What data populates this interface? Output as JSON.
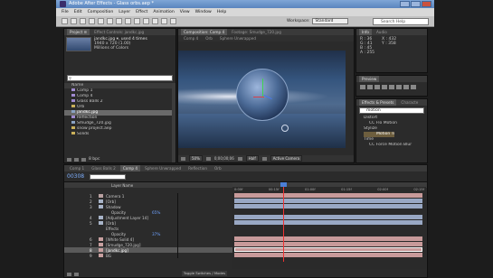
{
  "window": {
    "title": "Adobe After Effects - Glass orbs.aep *"
  },
  "menu": [
    "File",
    "Edit",
    "Composition",
    "Layer",
    "Effect",
    "Animation",
    "View",
    "Window",
    "Help"
  ],
  "toolbar": {
    "workspace_label": "Workspace:",
    "workspace_value": "Standard",
    "search_placeholder": "Search Help"
  },
  "project": {
    "tabs": [
      "Project ≡",
      "Effect Controls: jandkc.jpg"
    ],
    "preview_name": "jandkc.jpg ▾, used 4 times",
    "preview_size": "1940 x 720 (1.00)",
    "preview_desc": "Millions of Colors",
    "column_name": "Name",
    "items": [
      {
        "name": "Comp 1",
        "type": "comp"
      },
      {
        "name": "Comp 4",
        "type": "comp"
      },
      {
        "name": "Glass Balls 2",
        "type": "comp"
      },
      {
        "name": "Orb",
        "type": "folder"
      },
      {
        "name": "jandkc.jpg",
        "type": "img",
        "selected": true
      },
      {
        "name": "Reflection",
        "type": "comp"
      },
      {
        "name": "Smudge_720.jpg",
        "type": "img"
      },
      {
        "name": "snow project.aep",
        "type": "folder"
      },
      {
        "name": "Solids",
        "type": "folder"
      }
    ],
    "bpc": "8 bpc"
  },
  "composition": {
    "tabs": [
      "Composition: Comp 4",
      "Footage: Smudge_720.jpg"
    ],
    "breadcrumbs": [
      "Comp 4",
      "Orb",
      "Sphere Unwrapped"
    ],
    "zoom": "50%",
    "timecode": "0;00;00;06",
    "resolution": "Half",
    "camera": "Active Camera"
  },
  "info": {
    "tabs": [
      "Info",
      "Audio"
    ],
    "r": "R : 36",
    "g": "G : 41",
    "b": "B : 45",
    "a": "A : 255",
    "x": "X : 432",
    "y": "Y : 358"
  },
  "preview": {
    "tab": "Preview"
  },
  "effects": {
    "tabs": [
      "Effects & Presets",
      "Characte"
    ],
    "search_value": "motion",
    "categories": [
      {
        "name": "Distort",
        "item": "CC Flo Motion"
      },
      {
        "name": "Stylize",
        "item": "Motion Tile",
        "selected": true
      },
      {
        "name": "Time",
        "item": "CC Force Motion Blur"
      }
    ]
  },
  "timeline": {
    "tabs": [
      "Comp 1",
      "Glass Balls 2",
      "Comp 4",
      "Sphere Unwrapped",
      "Reflection",
      "Orb"
    ],
    "timecode": "00308",
    "header_layer": "Layer Name",
    "layers": [
      {
        "num": "1",
        "name": "Camera 1",
        "color": "#b8a0a0"
      },
      {
        "num": "2",
        "name": "[Orb]",
        "color": "#a8b4c8"
      },
      {
        "num": "3",
        "name": "Shadow",
        "color": "#a8b4c8"
      },
      {
        "num": "",
        "name": "Opacity",
        "value": "65%",
        "sub": true
      },
      {
        "num": "4",
        "name": "[Adjustment Layer 14]",
        "color": "#a8b4c8"
      },
      {
        "num": "5",
        "name": "[Orb]",
        "color": "#a8b4c8"
      },
      {
        "num": "",
        "name": "Effects",
        "sub": true
      },
      {
        "num": "",
        "name": "Opacity",
        "value": "37%",
        "sub": true
      },
      {
        "num": "6",
        "name": "[White Solid 4]",
        "color": "#c8a0a0"
      },
      {
        "num": "7",
        "name": "[Smudge_720.jpg]",
        "color": "#c8a0a0"
      },
      {
        "num": "8",
        "name": "[jandkc.jpg]",
        "color": "#c8a0a0",
        "selected": true
      },
      {
        "num": "9",
        "name": "BG",
        "color": "#c8a0a0"
      }
    ],
    "ruler": [
      "0:00f",
      "00:15f",
      "01:00f",
      "01:15f",
      "02:00f",
      "02:15f"
    ],
    "toggle_label": "Toggle Switches / Modes"
  }
}
